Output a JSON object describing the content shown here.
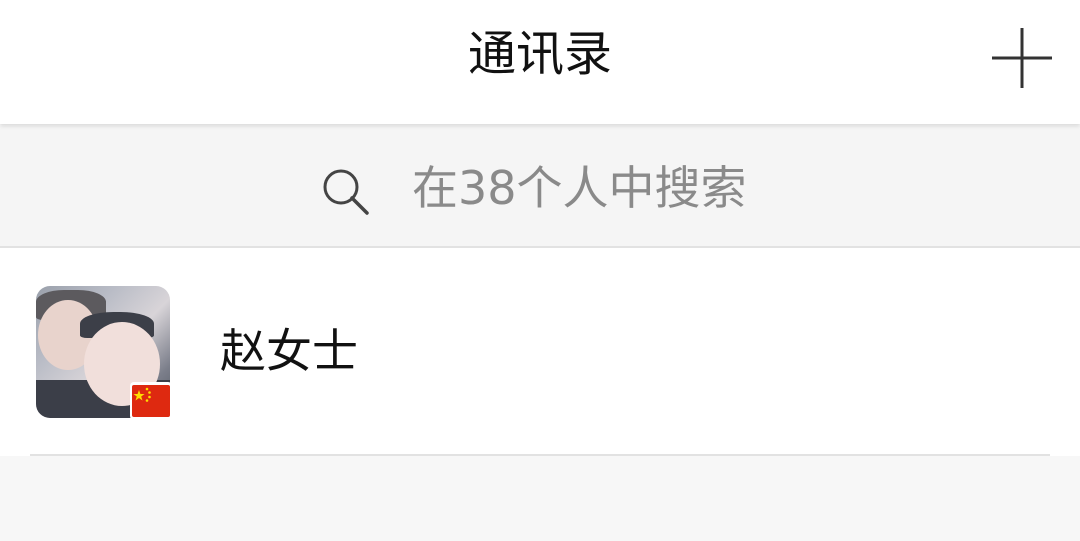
{
  "header": {
    "title": "通讯录",
    "add_icon": "plus-icon"
  },
  "search": {
    "placeholder": "在38个人中搜索",
    "icon": "search-icon"
  },
  "contacts": [
    {
      "name": "赵女士",
      "avatar": "photo-avatar",
      "badge_icon": "china-flag-icon"
    }
  ],
  "colors": {
    "header_bg": "#ffffff",
    "page_bg": "#f7f7f7",
    "placeholder_text": "#8a8a8a",
    "flag_red": "#de2910",
    "flag_yellow": "#ffde00"
  }
}
